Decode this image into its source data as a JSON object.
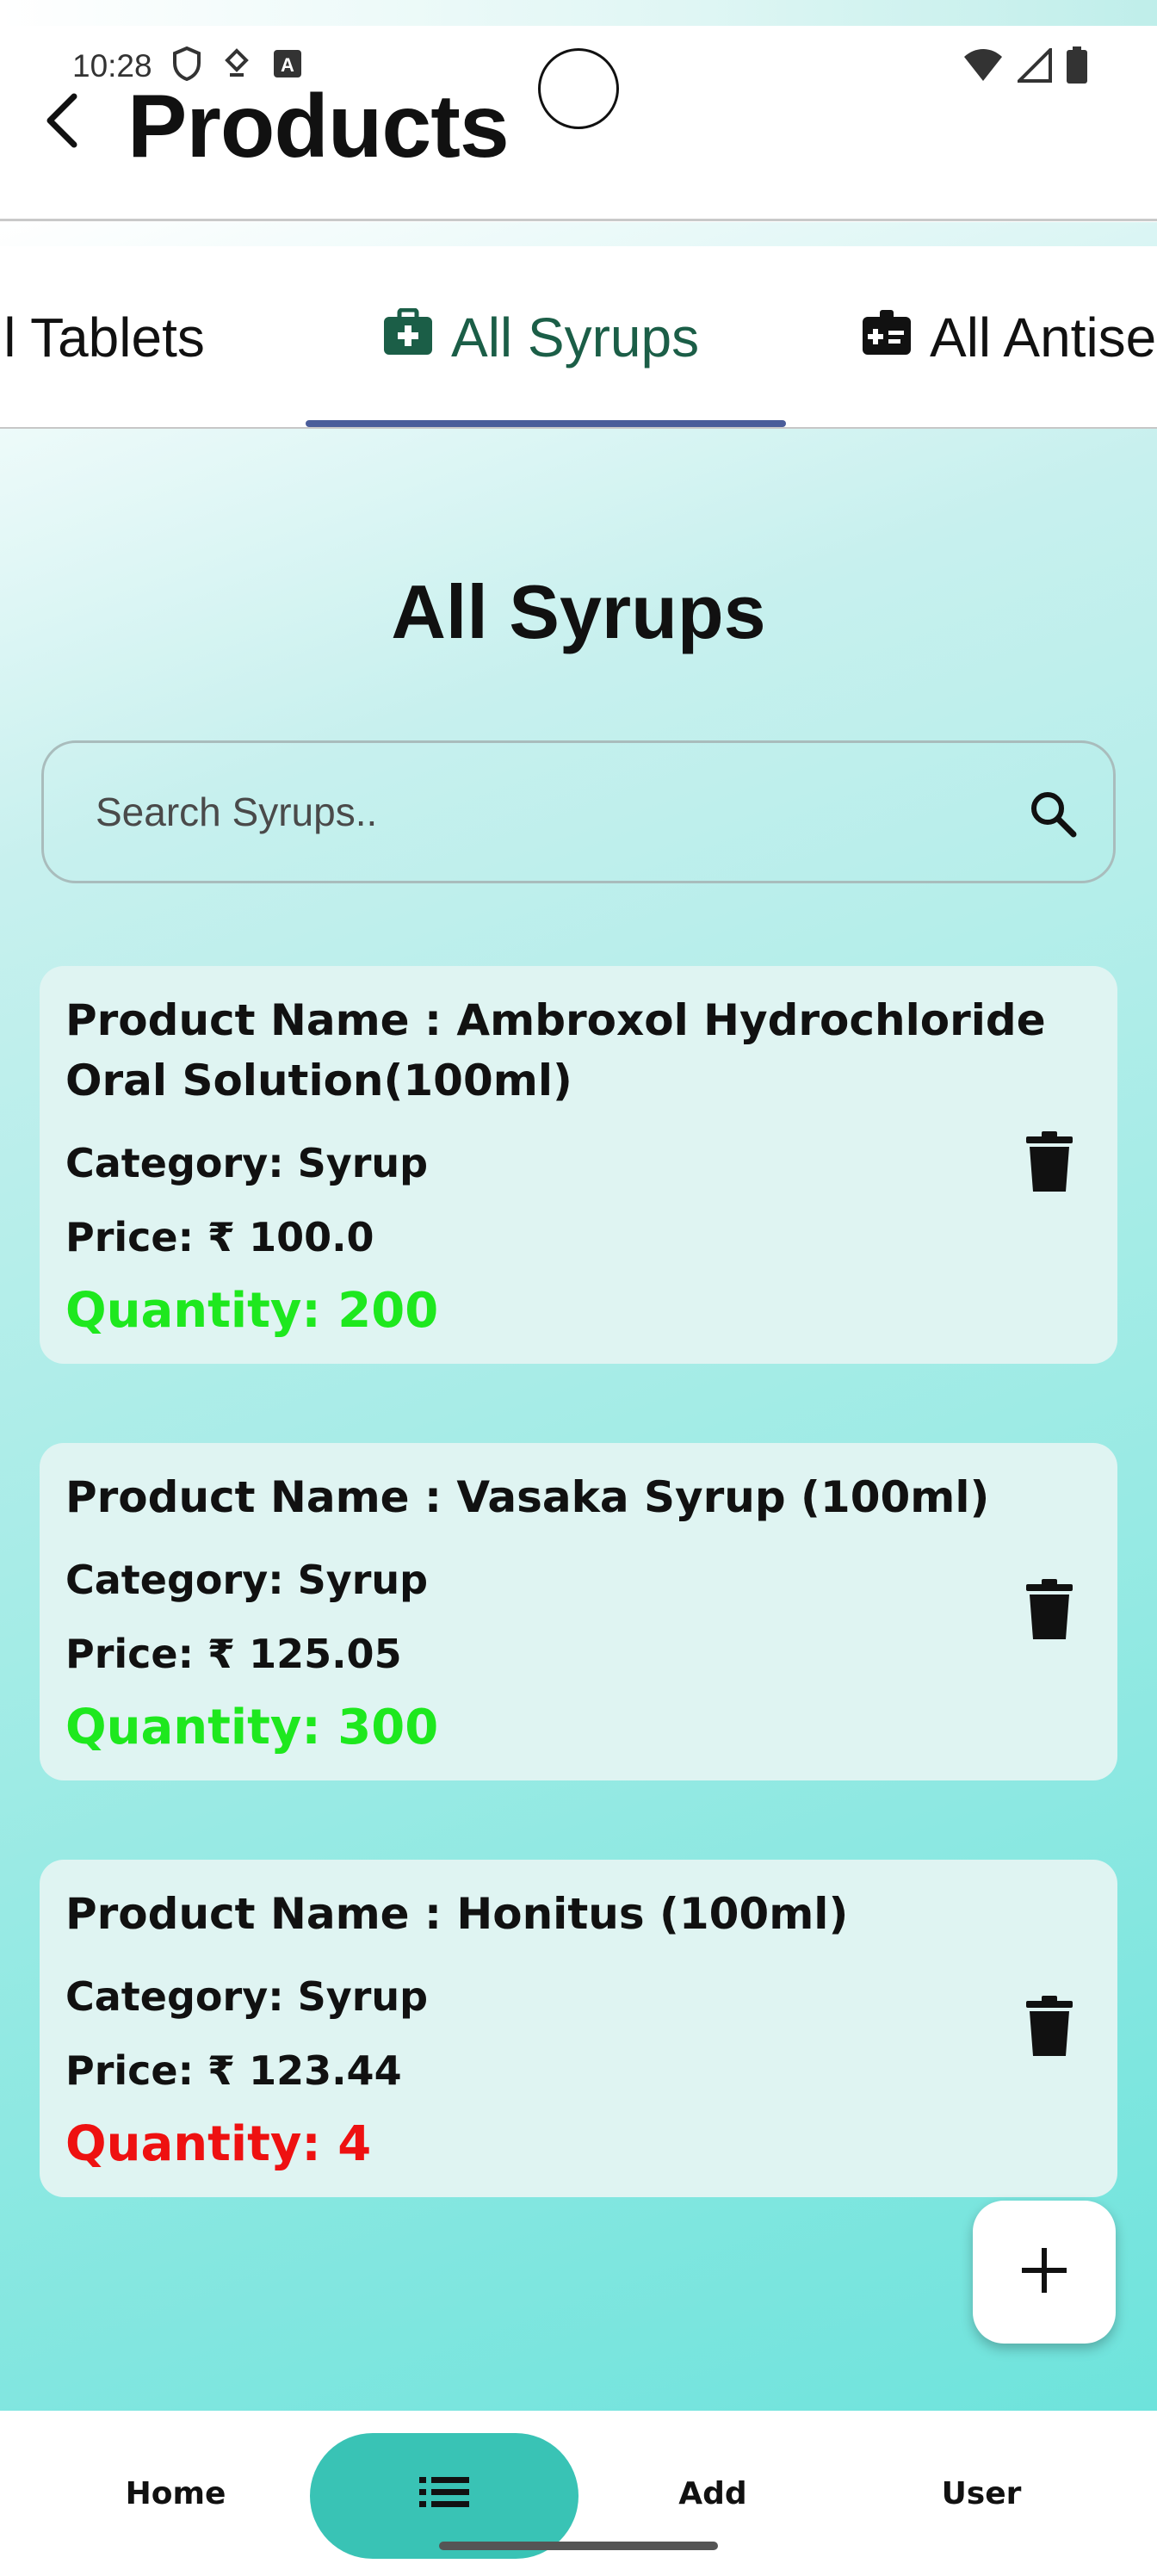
{
  "status_bar": {
    "time": "10:28",
    "left_icons": [
      "shield-icon",
      "download-icon",
      "translate-icon"
    ],
    "right_icons": [
      "wifi-icon",
      "signal-icon",
      "battery-icon"
    ]
  },
  "app_bar": {
    "title": "Products",
    "back_icon": "back-arrow-icon"
  },
  "tabs": [
    {
      "label": "ll Tablets",
      "icon": "",
      "selected": false
    },
    {
      "label": "All Syrups",
      "icon": "medical-bag-icon",
      "selected": true
    },
    {
      "label": "All Antise",
      "icon": "medical-id-icon",
      "selected": false
    }
  ],
  "section_title": "All Syrups",
  "search": {
    "placeholder": "Search Syrups..",
    "value": ""
  },
  "products": [
    {
      "name": "Product Name : Ambroxol Hydrochloride Oral Solution(100ml)",
      "category": "Category: Syrup",
      "price": "Price: ₹ 100.0",
      "quantity": "Quantity: 200",
      "quantity_status": "ok"
    },
    {
      "name": "Product Name : Vasaka Syrup (100ml)",
      "category": "Category: Syrup",
      "price": "Price: ₹ 125.05",
      "quantity": "Quantity: 300",
      "quantity_status": "ok"
    },
    {
      "name": "Product Name : Honitus (100ml)",
      "category": "Category: Syrup",
      "price": "Price: ₹ 123.44",
      "quantity": "Quantity: 4",
      "quantity_status": "low"
    }
  ],
  "fab_icon": "plus-icon",
  "bottom_nav": {
    "home": "Home",
    "list_icon": "list-icon",
    "add": "Add",
    "user": "User"
  },
  "colors": {
    "tab_selected_text": "#1b5e47",
    "tab_indicator": "#4a5d9a",
    "quantity_ok": "#1ee81e",
    "quantity_low": "#ee1111",
    "nav_pill": "#39c3b5",
    "card_background": "#dff4f2"
  }
}
